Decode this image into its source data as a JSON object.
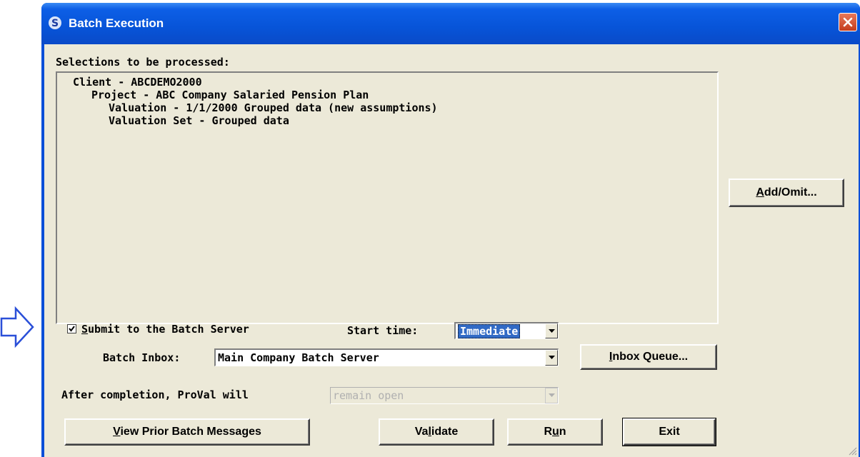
{
  "window": {
    "title": "Batch Execution"
  },
  "selections": {
    "label": "Selections to be processed:",
    "tree": [
      {
        "text": "Client - ABCDEMO2000",
        "level": 0
      },
      {
        "text": "Project - ABC Company Salaried Pension Plan",
        "level": 1
      },
      {
        "text": "Valuation - 1/1/2000 Grouped data (new assumptions)",
        "level": 2
      },
      {
        "text": "Valuation Set - Grouped data",
        "level": 2
      }
    ]
  },
  "buttons": {
    "add_omit": {
      "prefix": "",
      "accel": "A",
      "rest": "dd/Omit..."
    },
    "inbox_queue": {
      "prefix": "",
      "accel": "I",
      "rest": "nbox Queue..."
    },
    "view_prior": {
      "prefix": "",
      "accel": "V",
      "rest": "iew Prior Batch Messages"
    },
    "validate": {
      "prefix": "Va",
      "accel": "l",
      "rest": "idate"
    },
    "run": {
      "prefix": "R",
      "accel": "u",
      "rest": "n"
    },
    "exit": {
      "prefix": "Exit",
      "accel": "",
      "rest": ""
    }
  },
  "submit": {
    "checked": true,
    "accel": "S",
    "rest": "ubmit to the Batch Server"
  },
  "start_time": {
    "label": "Start time:",
    "value": "Immediate"
  },
  "batch_inbox": {
    "label": "Batch Inbox:",
    "value": "Main Company Batch Server"
  },
  "after_completion": {
    "label": "After completion, ProVal will",
    "value": "remain open"
  },
  "colors": {
    "titlebar": "#0754d8",
    "dialog_bg": "#ece9d8",
    "selection": "#316ac5",
    "arrow": "#2a4fd8"
  }
}
